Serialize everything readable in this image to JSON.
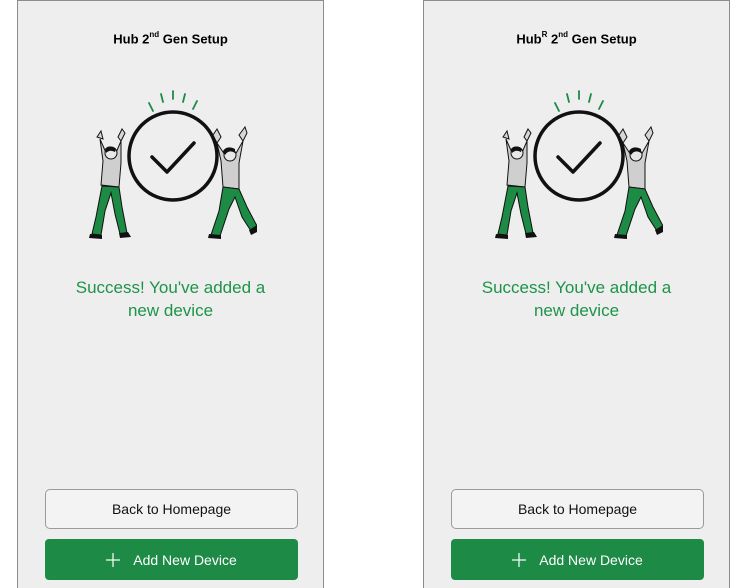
{
  "screens": [
    {
      "title": {
        "prefix": "Hub",
        "superscript_r": "",
        "mid": " 2",
        "ordinal": "nd",
        "suffix": " Gen Setup"
      },
      "illustration_icon": "success-celebration-icon",
      "message_line1": "Success! You've added a",
      "message_line2": "new device",
      "back_label": "Back to Homepage",
      "add_label": "Add New Device"
    },
    {
      "title": {
        "prefix": "Hub",
        "superscript_r": "R",
        "mid": " 2",
        "ordinal": "nd",
        "suffix": " Gen Setup"
      },
      "illustration_icon": "success-celebration-icon",
      "message_line1": "Success! You've added a",
      "message_line2": "new device",
      "back_label": "Back to Homepage",
      "add_label": "Add New Device"
    }
  ],
  "colors": {
    "success_text": "#1d9448",
    "primary_button": "#1d8a45",
    "screen_background": "#eeeeee",
    "figure_green": "#1d8a45"
  }
}
